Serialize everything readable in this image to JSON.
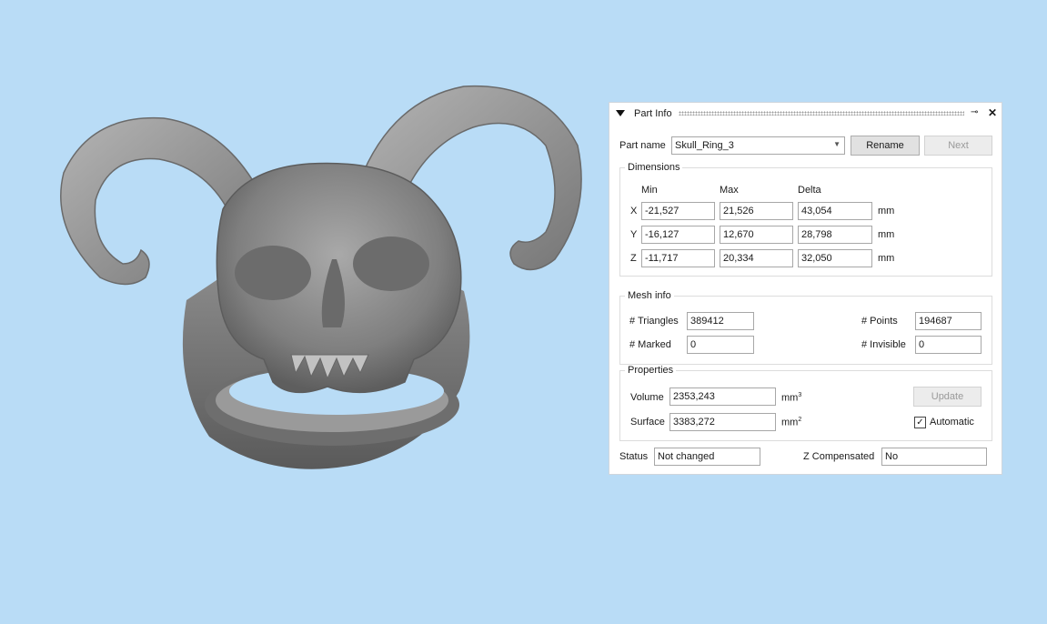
{
  "panel": {
    "title": "Part Info",
    "part_name_label": "Part name",
    "part_name_value": "Skull_Ring_3",
    "rename_label": "Rename",
    "next_label": "Next"
  },
  "dimensions": {
    "title": "Dimensions",
    "headers": [
      "Min",
      "Max",
      "Delta"
    ],
    "rows": [
      {
        "axis": "X",
        "min": "-21,527",
        "max": "21,526",
        "delta": "43,054",
        "unit": "mm"
      },
      {
        "axis": "Y",
        "min": "-16,127",
        "max": "12,670",
        "delta": "28,798",
        "unit": "mm"
      },
      {
        "axis": "Z",
        "min": "-11,717",
        "max": "20,334",
        "delta": "32,050",
        "unit": "mm"
      }
    ]
  },
  "mesh": {
    "title": "Mesh info",
    "triangles_label": "# Triangles",
    "triangles_value": "389412",
    "points_label": "# Points",
    "points_value": "194687",
    "marked_label": "# Marked",
    "marked_value": "0",
    "invisible_label": "# Invisible",
    "invisible_value": "0"
  },
  "properties": {
    "title": "Properties",
    "volume_label": "Volume",
    "volume_value": "2353,243",
    "volume_unit": "mm",
    "volume_exp": "3",
    "surface_label": "Surface",
    "surface_value": "3383,272",
    "surface_unit": "mm",
    "surface_exp": "2",
    "update_label": "Update",
    "automatic_label": "Automatic",
    "automatic_checked": true
  },
  "status": {
    "status_label": "Status",
    "status_value": "Not changed",
    "zcomp_label": "Z Compensated",
    "zcomp_value": "No"
  },
  "colors": {
    "viewport_background": "#b9dcf6",
    "model_gray": "#8e8e8e"
  }
}
